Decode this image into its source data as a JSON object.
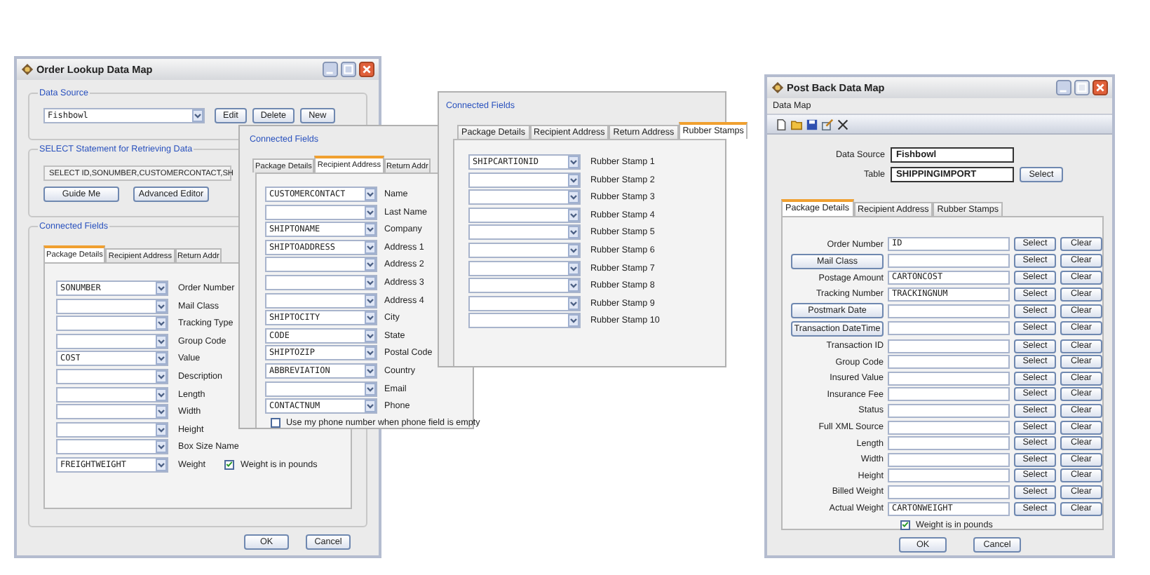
{
  "order_lookup_window": {
    "title": "Order Lookup Data Map",
    "data_source": {
      "label": "Data Source",
      "value": "Fishbowl",
      "buttons": [
        "Edit",
        "Delete",
        "New"
      ]
    },
    "select_statement": {
      "label": "SELECT Statement for Retrieving Data",
      "value": "SELECT ID,SONUMBER,CUSTOMERCONTACT,SH",
      "buttons": [
        "Guide Me",
        "Advanced Editor"
      ]
    },
    "connected_fields": {
      "label": "Connected Fields",
      "tabs": [
        {
          "label": "Package Details",
          "selected": true
        },
        {
          "label": "Recipient Address",
          "selected": false
        },
        {
          "label": "Return Addr",
          "selected": false
        }
      ],
      "rows": [
        {
          "value": "SONUMBER",
          "label": "Order Number"
        },
        {
          "label": "Mail Class"
        },
        {
          "label": "Tracking Type"
        },
        {
          "label": "Group Code"
        },
        {
          "value": "COST",
          "label": "Value"
        },
        {
          "label": "Description"
        },
        {
          "label": "Length"
        },
        {
          "label": "Width"
        },
        {
          "label": "Height"
        },
        {
          "label": "Box Size Name"
        },
        {
          "value": "FREIGHTWEIGHT",
          "label": "Weight",
          "checkbox": {
            "label": "Weight is in pounds",
            "checked": true
          }
        }
      ]
    },
    "buttons": [
      "OK",
      "Cancel"
    ]
  },
  "recipient_panel": {
    "label": "Connected Fields",
    "tabs": [
      {
        "label": "Package Details",
        "selected": false
      },
      {
        "label": "Recipient Address",
        "selected": true
      },
      {
        "label": "Return Addr",
        "selected": false
      }
    ],
    "rows": [
      {
        "value": "CUSTOMERCONTACT",
        "label": "Name"
      },
      {
        "label": "Last Name"
      },
      {
        "value": "SHIPTONAME",
        "label": "Company"
      },
      {
        "value": "SHIPTOADDRESS",
        "label": "Address 1"
      },
      {
        "label": "Address 2"
      },
      {
        "label": "Address 3"
      },
      {
        "label": "Address 4"
      },
      {
        "value": "SHIPTOCITY",
        "label": "City"
      },
      {
        "value": "CODE",
        "label": "State"
      },
      {
        "value": "SHIPTOZIP",
        "label": "Postal Code"
      },
      {
        "value": "ABBREVIATION",
        "label": "Country"
      },
      {
        "label": "Email"
      },
      {
        "value": "CONTACTNUM",
        "label": "Phone"
      }
    ],
    "checkbox": {
      "label": "Use my phone number when phone field is empty",
      "checked": false
    }
  },
  "rubber_stamps_panel": {
    "label": "Connected Fields",
    "tabs": [
      {
        "label": "Package Details",
        "selected": false
      },
      {
        "label": "Recipient Address",
        "selected": false
      },
      {
        "label": "Return Address",
        "selected": false
      },
      {
        "label": "Rubber Stamps",
        "selected": true
      }
    ],
    "rows": [
      {
        "value": "SHIPCARTIONID",
        "label": "Rubber Stamp 1"
      },
      {
        "label": "Rubber Stamp 2"
      },
      {
        "label": "Rubber Stamp 3"
      },
      {
        "label": "Rubber Stamp 4"
      },
      {
        "label": "Rubber Stamp 5"
      },
      {
        "label": "Rubber Stamp 6"
      },
      {
        "label": "Rubber Stamp 7"
      },
      {
        "label": "Rubber Stamp 8"
      },
      {
        "label": "Rubber Stamp 9"
      },
      {
        "label": "Rubber Stamp 10"
      }
    ]
  },
  "post_back_window": {
    "title": "Post Back Data Map",
    "menu": [
      "Data Map"
    ],
    "data_source": {
      "label": "Data Source",
      "value": "Fishbowl"
    },
    "table": {
      "label": "Table",
      "value": "SHIPPINGIMPORT",
      "button": "Select"
    },
    "tabs": [
      {
        "label": "Package Details",
        "selected": true
      },
      {
        "label": "Recipient Address",
        "selected": false
      },
      {
        "label": "Rubber Stamps",
        "selected": false
      }
    ],
    "rows": [
      {
        "kind": "label",
        "label": "Order Number",
        "value": "ID",
        "select": "Select",
        "clear": "Clear"
      },
      {
        "kind": "button",
        "label": "Mail Class",
        "select": "Select",
        "clear": "Clear"
      },
      {
        "kind": "label",
        "label": "Postage Amount",
        "value": "CARTONCOST",
        "select": "Select",
        "clear": "Clear"
      },
      {
        "kind": "label",
        "label": "Tracking Number",
        "value": "TRACKINGNUM",
        "select": "Select",
        "clear": "Clear"
      },
      {
        "kind": "button",
        "label": "Postmark Date",
        "select": "Select",
        "clear": "Clear"
      },
      {
        "kind": "button",
        "label": "Transaction DateTime",
        "select": "Select",
        "clear": "Clear"
      },
      {
        "kind": "label",
        "label": "Transaction ID",
        "select": "Select",
        "clear": "Clear"
      },
      {
        "kind": "label",
        "label": "Group Code",
        "select": "Select",
        "clear": "Clear"
      },
      {
        "kind": "label",
        "label": "Insured Value",
        "select": "Select",
        "clear": "Clear"
      },
      {
        "kind": "label",
        "label": "Insurance Fee",
        "select": "Select",
        "clear": "Clear"
      },
      {
        "kind": "label",
        "label": "Status",
        "select": "Select",
        "clear": "Clear"
      },
      {
        "kind": "label",
        "label": "Full XML Source",
        "select": "Select",
        "clear": "Clear"
      },
      {
        "kind": "label",
        "label": "Length",
        "select": "Select",
        "clear": "Clear"
      },
      {
        "kind": "label",
        "label": "Width",
        "select": "Select",
        "clear": "Clear"
      },
      {
        "kind": "label",
        "label": "Height",
        "select": "Select",
        "clear": "Clear"
      },
      {
        "kind": "label",
        "label": "Billed Weight",
        "select": "Select",
        "clear": "Clear"
      },
      {
        "kind": "label",
        "label": "Actual Weight",
        "value": "CARTONWEIGHT",
        "select": "Select",
        "clear": "Clear"
      }
    ],
    "checkbox": {
      "label": "Weight is in pounds",
      "checked": true
    },
    "buttons": [
      "OK",
      "Cancel"
    ]
  }
}
